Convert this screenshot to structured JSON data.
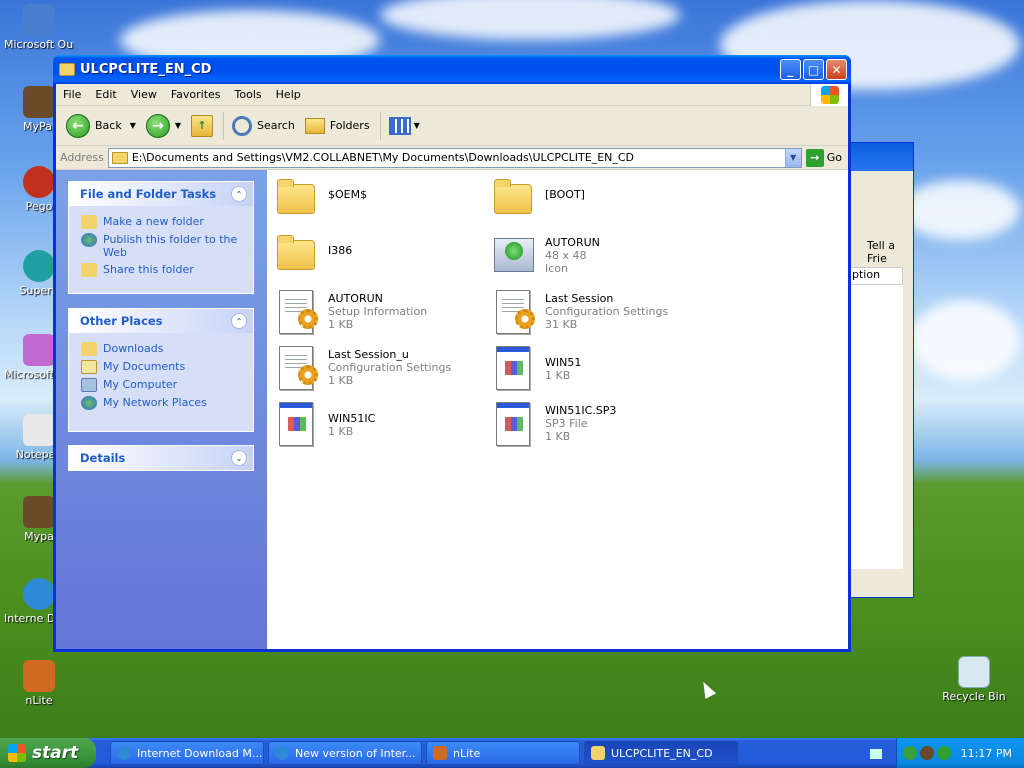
{
  "desktop": {
    "icons": [
      {
        "label": "Microsoft Outlo",
        "color": "#4a7fd0"
      },
      {
        "label": "MyPal",
        "color": "#6b4a2a"
      },
      {
        "label": "Pego",
        "color": "#c0301e"
      },
      {
        "label": "Supern",
        "color": "#20a0a0"
      },
      {
        "label": "Microsoft Studio",
        "color": "#c06ad0"
      },
      {
        "label": "Notepad",
        "color": "#e8e8e8"
      },
      {
        "label": "Mypa",
        "color": "#6b4a2a"
      },
      {
        "label": "Interne Downlo",
        "color": "#2e8ad6"
      },
      {
        "label": "nLite",
        "color": "#d06a20"
      }
    ],
    "recycle_bin": "Recycle Bin",
    "bg_window": {
      "toolbar_label": "Tell a Frie",
      "column_label": "ption"
    }
  },
  "window": {
    "title": "ULCPCLITE_EN_CD",
    "menu": [
      "File",
      "Edit",
      "View",
      "Favorites",
      "Tools",
      "Help"
    ],
    "toolbar": {
      "back": "Back",
      "search": "Search",
      "folders": "Folders"
    },
    "address": {
      "label": "Address",
      "path": "E:\\Documents and Settings\\VM2.COLLABNET\\My Documents\\Downloads\\ULCPCLITE_EN_CD",
      "go": "Go"
    }
  },
  "left_pane": {
    "file_tasks": {
      "title": "File and Folder Tasks",
      "items": [
        "Make a new folder",
        "Publish this folder to the Web",
        "Share this folder"
      ]
    },
    "other_places": {
      "title": "Other Places",
      "items": [
        "Downloads",
        "My Documents",
        "My Computer",
        "My Network Places"
      ]
    },
    "details": {
      "title": "Details"
    }
  },
  "files": [
    {
      "name": "$OEM$",
      "line2": "",
      "line3": "",
      "icon": "folder-icon"
    },
    {
      "name": "[BOOT]",
      "line2": "",
      "line3": "",
      "icon": "folder-icon"
    },
    {
      "name": "I386",
      "line2": "",
      "line3": "",
      "icon": "folder-icon"
    },
    {
      "name": "AUTORUN",
      "line2": "48 x 48",
      "line3": "Icon",
      "icon": "autorun-icon"
    },
    {
      "name": "AUTORUN",
      "line2": "Setup Information",
      "line3": "1 KB",
      "icon": "setup-info-icon"
    },
    {
      "name": "Last Session",
      "line2": "Configuration Settings",
      "line3": "31 KB",
      "icon": "config-settings-icon"
    },
    {
      "name": "Last Session_u",
      "line2": "Configuration Settings",
      "line3": "1 KB",
      "icon": "config-settings-icon"
    },
    {
      "name": "WIN51",
      "line2": "1 KB",
      "line3": "",
      "icon": "generic-file-icon"
    },
    {
      "name": "WIN51IC",
      "line2": "1 KB",
      "line3": "",
      "icon": "generic-file-icon"
    },
    {
      "name": "WIN51IC.SP3",
      "line2": "SP3 File",
      "line3": "1 KB",
      "icon": "generic-file-icon"
    }
  ],
  "taskbar": {
    "start": "start",
    "tasks": [
      "Internet Download M...",
      "New version of Inter...",
      "nLite",
      "ULCPCLITE_EN_CD"
    ],
    "clock": "11:17 PM"
  }
}
